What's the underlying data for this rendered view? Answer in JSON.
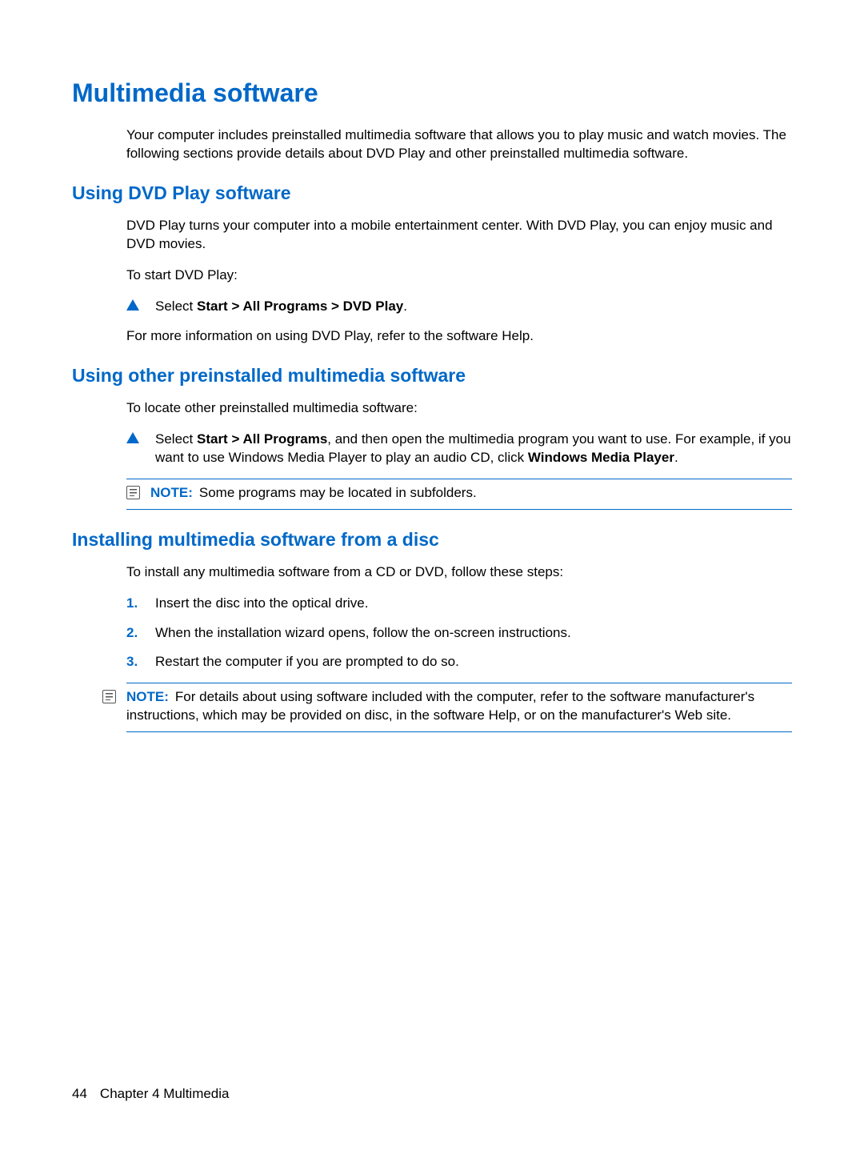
{
  "h1": "Multimedia software",
  "intro": "Your computer includes preinstalled multimedia software that allows you to play music and watch movies. The following sections provide details about DVD Play and other preinstalled multimedia software.",
  "s1": {
    "heading": "Using DVD Play software",
    "p1": "DVD Play turns your computer into a mobile entertainment center. With DVD Play, you can enjoy music and DVD movies.",
    "p2": "To start DVD Play:",
    "step_prefix": "Select ",
    "step_bold": "Start > All Programs > DVD Play",
    "step_suffix": ".",
    "p3": "For more information on using DVD Play, refer to the software Help."
  },
  "s2": {
    "heading": "Using other preinstalled multimedia software",
    "p1": "To locate other preinstalled multimedia software:",
    "step_a": "Select ",
    "step_a_bold": "Start > All Programs",
    "step_b": ", and then open the multimedia program you want to use. For example, if you want to use Windows Media Player to play an audio CD, click ",
    "step_b_bold": "Windows Media Player",
    "step_c": ".",
    "note_label": "NOTE:",
    "note_text": "Some programs may be located in subfolders."
  },
  "s3": {
    "heading": "Installing multimedia software from a disc",
    "p1": "To install any multimedia software from a CD or DVD, follow these steps:",
    "items": [
      {
        "n": "1.",
        "t": "Insert the disc into the optical drive."
      },
      {
        "n": "2.",
        "t": "When the installation wizard opens, follow the on-screen instructions."
      },
      {
        "n": "3.",
        "t": "Restart the computer if you are prompted to do so."
      }
    ],
    "note_label": "NOTE:",
    "note_text": "For details about using software included with the computer, refer to the software manufacturer's instructions, which may be provided on disc, in the software Help, or on the manufacturer's Web site."
  },
  "footer": {
    "page": "44",
    "chapter": "Chapter 4   Multimedia"
  }
}
